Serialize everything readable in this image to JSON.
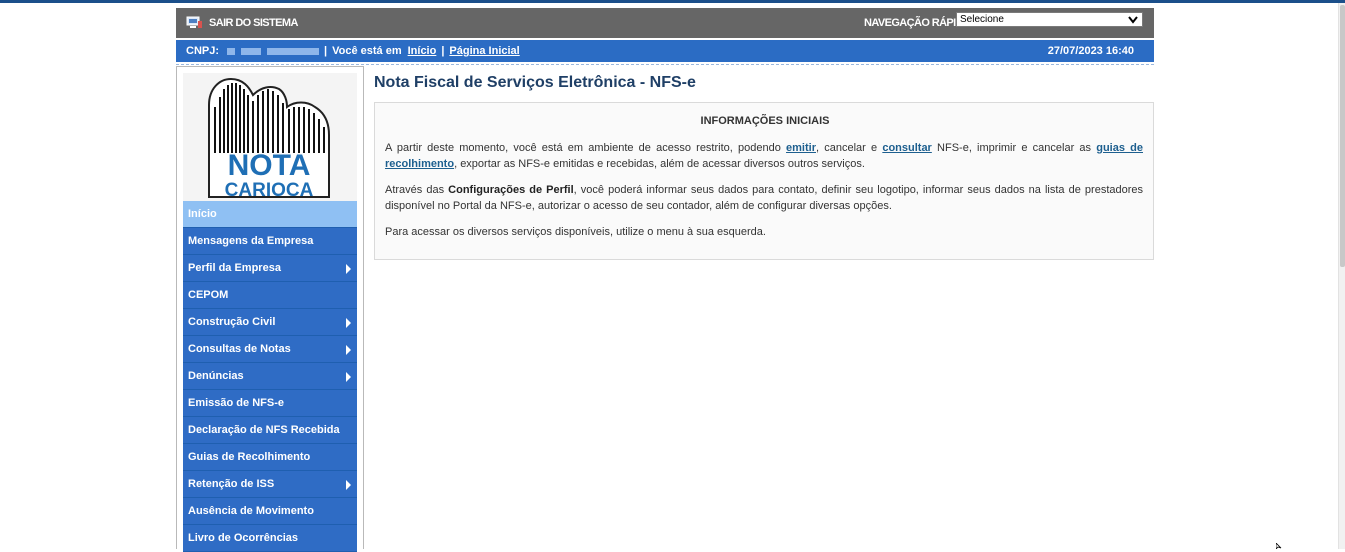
{
  "header": {
    "exit_label": "SAIR DO SISTEMA",
    "quicknav_label": "NAVEGAÇÃO RÁPIDA",
    "quicknav_value": "Selecione"
  },
  "infobar": {
    "cnpj_label": "CNPJ:",
    "location_label": "Você está em",
    "link_inicio": "Início",
    "link_pagina_inicial": "Página Inicial",
    "datetime": "27/07/2023 16:40"
  },
  "logo": {
    "line1": "NOTA",
    "line2": "CARIOCA"
  },
  "menu": [
    {
      "label": "Início",
      "active": true,
      "submenu": false
    },
    {
      "label": "Mensagens da Empresa",
      "submenu": false
    },
    {
      "label": "Perfil da Empresa",
      "submenu": true
    },
    {
      "label": "CEPOM",
      "submenu": false
    },
    {
      "label": "Construção Civil",
      "submenu": true
    },
    {
      "label": "Consultas de Notas",
      "submenu": true
    },
    {
      "label": "Denúncias",
      "submenu": true
    },
    {
      "label": "Emissão de NFS-e",
      "submenu": false
    },
    {
      "label": "Declaração de NFS Recebida",
      "submenu": false
    },
    {
      "label": "Guias de Recolhimento",
      "submenu": false
    },
    {
      "label": "Retenção de ISS",
      "submenu": true
    },
    {
      "label": "Ausência de Movimento",
      "submenu": false
    },
    {
      "label": "Livro de Ocorrências",
      "submenu": false
    }
  ],
  "main": {
    "title": "Nota Fiscal de Serviços Eletrônica - NFS-e",
    "info_heading": "INFORMAÇÕES INICIAIS",
    "p1_a": "A partir deste momento, você está em ambiente de acesso restrito, podendo ",
    "p1_link1": "emitir",
    "p1_b": ", cancelar e ",
    "p1_link2": "consultar",
    "p1_c": " NFS-e, imprimir e cancelar as ",
    "p1_link3": "guias de recolhimento",
    "p1_d": ", exportar as NFS-e emitidas e recebidas, além de acessar diversos outros serviços.",
    "p2_a": "Através das ",
    "p2_bold": "Configurações de Perfil",
    "p2_b": ", você poderá informar seus dados para contato, definir seu logotipo, informar seus dados na lista de prestadores disponível no Portal da NFS-e, autorizar o acesso de seu contador, além de configurar diversas opções.",
    "p3": "Para acessar os diversos serviços disponíveis, utilize o menu à sua esquerda."
  },
  "colors": {
    "topbar": "#666666",
    "infobar": "#2b6cc4",
    "menu": "#2f6cc5",
    "menu_active": "#8fc0f3",
    "title": "#1f3f66"
  }
}
